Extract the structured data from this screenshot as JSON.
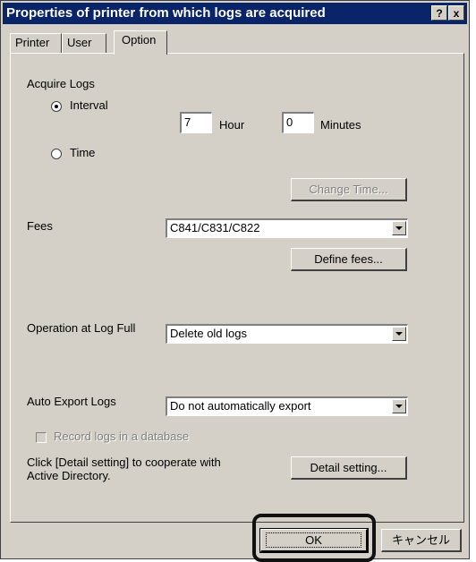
{
  "window": {
    "title": "Properties of printer from which logs are acquired",
    "help_label": "?",
    "close_label": "x"
  },
  "tabs": [
    {
      "label": "Printer",
      "active": false
    },
    {
      "label": "User",
      "active": false
    },
    {
      "label": "Option",
      "active": true
    }
  ],
  "acquire_logs": {
    "label": "Acquire Logs",
    "interval_label": "Interval",
    "interval_selected": true,
    "time_label": "Time",
    "hour_value": "7",
    "hour_label": "Hour",
    "minutes_value": "0",
    "minutes_label": "Minutes",
    "change_time_label": "Change Time..."
  },
  "fees": {
    "label": "Fees",
    "selected": "C841/C831/C822",
    "define_label": "Define fees..."
  },
  "log_full": {
    "label": "Operation at Log Full",
    "selected": "Delete old logs"
  },
  "auto_export": {
    "label": "Auto Export Logs",
    "selected": "Do not automatically export"
  },
  "database": {
    "label": "Record logs in a database",
    "checked": false
  },
  "active_directory": {
    "line1": "Click [Detail setting] to cooperate with",
    "line2": "Active Directory.",
    "button_label": "Detail setting..."
  },
  "footer": {
    "ok_label": "OK",
    "cancel_label": "キャンセル"
  }
}
